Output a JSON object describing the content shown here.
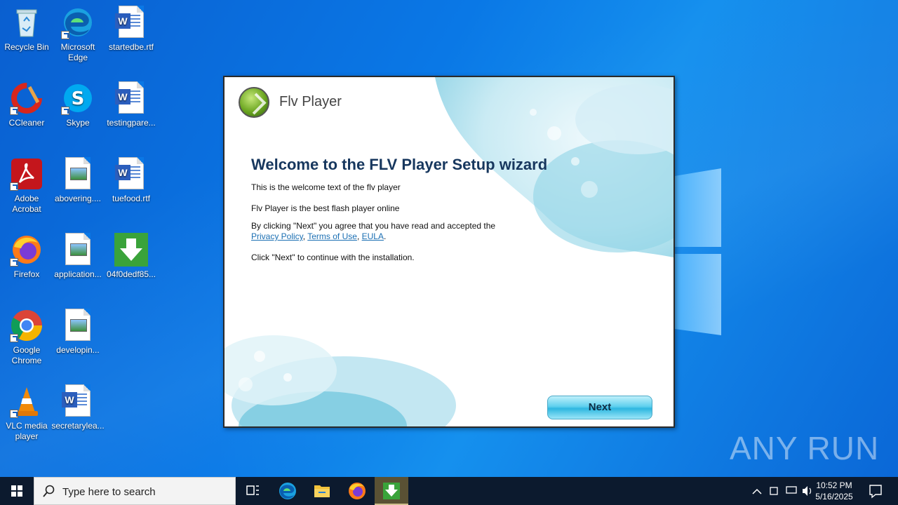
{
  "desktop": {
    "icons": [
      {
        "label": "Recycle Bin"
      },
      {
        "label": "Microsoft Edge"
      },
      {
        "label": "startedbe.rtf"
      },
      {
        "label": "CCleaner"
      },
      {
        "label": "Skype"
      },
      {
        "label": "testingpare..."
      },
      {
        "label": "Adobe Acrobat"
      },
      {
        "label": "abovering...."
      },
      {
        "label": "tuefood.rtf"
      },
      {
        "label": "Firefox"
      },
      {
        "label": "application..."
      },
      {
        "label": "04f0dedf85..."
      },
      {
        "label": "Google Chrome"
      },
      {
        "label": "developin..."
      },
      {
        "label": "VLC media player"
      },
      {
        "label": "secretarylea..."
      }
    ]
  },
  "dialog": {
    "app_name": "Flv Player",
    "title": "Welcome to the FLV Player Setup wizard",
    "line1": "This is the welcome text of the flv player",
    "line2": "Flv Player is the best flash player online",
    "agree_text": "By clicking \"Next\" you agree that you have read and accepted the",
    "link_privacy": "Privacy Policy",
    "link_terms": "Terms of Use",
    "link_eula": "EULA",
    "sep1": ", ",
    "sep2": ", ",
    "end_period": ".",
    "continue_text": "Click \"Next\" to continue with the installation.",
    "next_label": "Next"
  },
  "watermark": "ANY RUN",
  "taskbar": {
    "search_placeholder": "Type here to search",
    "time": "10:52 PM",
    "date": "5/16/2025"
  },
  "colors": {
    "accent": "#0a78e6",
    "dialog_title": "#17375e",
    "link": "#1b6fb3",
    "taskbar": "#0c1a2e"
  }
}
